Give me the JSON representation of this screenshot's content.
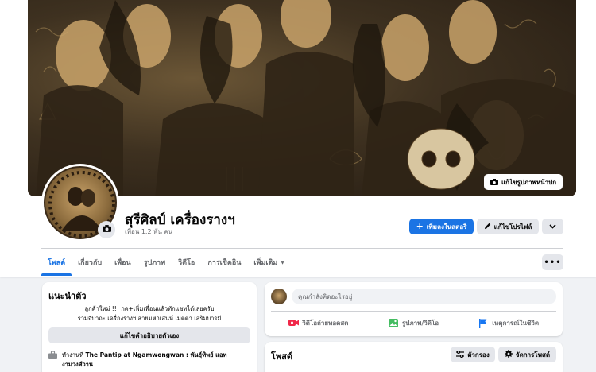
{
  "profile": {
    "name": "สุรีศิลป์ เครื่องรางฯ",
    "friends": "เพื่อน 1.2 พัน คน",
    "edit_cover_label": "แก้ไขรูปภาพหน้าปก"
  },
  "actions": {
    "add_story": "เพิ่มลงในสตอรี่",
    "edit_profile": "แก้ไขโปรไฟล์"
  },
  "tabs": [
    {
      "label": "โพสต์"
    },
    {
      "label": "เกี่ยวกับ"
    },
    {
      "label": "เพื่อน"
    },
    {
      "label": "รูปภาพ"
    },
    {
      "label": "วิดีโอ"
    },
    {
      "label": "การเช็คอิน"
    },
    {
      "label": "เพิ่มเติม"
    }
  ],
  "intro": {
    "title": "แนะนำตัว",
    "bio_line1": "ลูกค้าใหม่ !!! กด+เพิ่มเพื่อนแล้วทักแชทได้เลยครับ",
    "bio_line2": "รวมจีปาถะ เครื่องรางฯ สายมหาเสน่ห์ เมตตา เสริมบารมี",
    "edit_bio": "แก้ไขคำอธิบายตัวเอง",
    "work_prefix": "ทำงานที่",
    "work_place": "The Pantip at Ngamwongwan : พันธุ์ทิพย์ แอท งามวงศ์วาน"
  },
  "composer": {
    "placeholder": "คุณกำลังคิดอะไรอยู่",
    "live": "วิดีโอถ่ายทอดสด",
    "photo": "รูปภาพ/วิดีโอ",
    "event": "เหตุการณ์ในชีวิต"
  },
  "posts": {
    "title": "โพสต์",
    "filter": "ตัวกรอง",
    "manage": "จัดการโพสต์"
  },
  "icons": {
    "camera": "camera-icon",
    "plus": "plus-icon",
    "pencil": "pencil-icon",
    "chevron": "chevron-down-icon",
    "briefcase": "briefcase-icon",
    "live_video": "live-video-icon",
    "photo": "photo-icon",
    "flag": "flag-icon",
    "filter": "filter-icon",
    "gear": "gear-icon"
  },
  "colors": {
    "accent": "#1b74e4",
    "live_red": "#f02849",
    "photo_green": "#45bd62",
    "event_blue": "#1877f2",
    "cover_tone": "#4a3a24"
  }
}
